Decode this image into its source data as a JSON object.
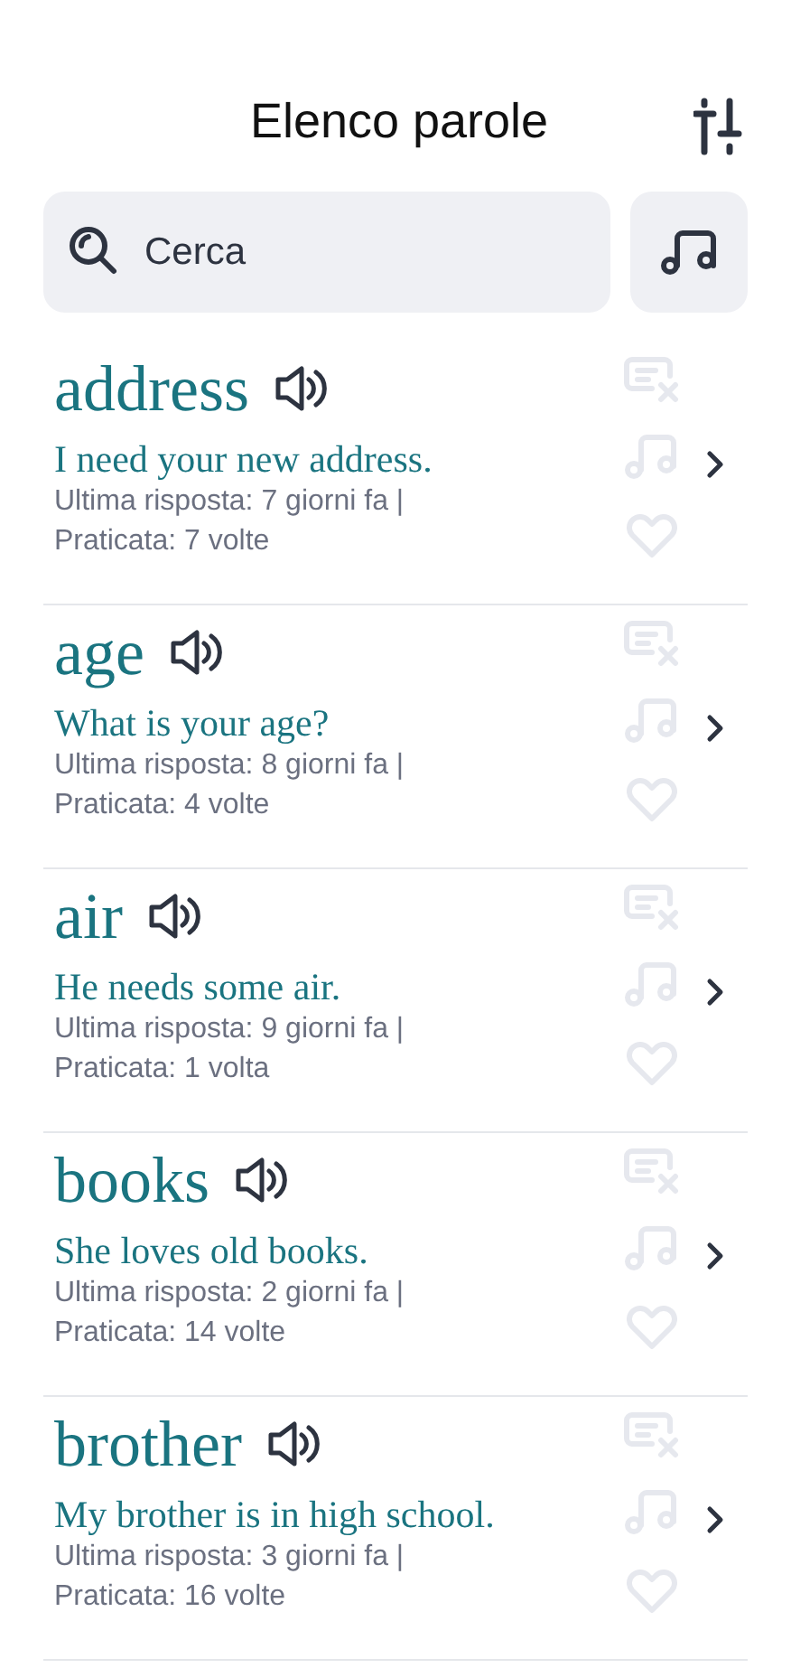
{
  "header": {
    "title": "Elenco parole"
  },
  "search": {
    "placeholder": "Cerca"
  },
  "words": [
    {
      "word": "address",
      "sentence": "I need your new address.",
      "last_answer": "Ultima risposta: 7 giorni fa |",
      "practiced": "Praticata: 7 volte"
    },
    {
      "word": "age",
      "sentence": "What is your age?",
      "last_answer": "Ultima risposta: 8 giorni fa |",
      "practiced": "Praticata: 4 volte"
    },
    {
      "word": "air",
      "sentence": "He needs some air.",
      "last_answer": "Ultima risposta: 9 giorni fa |",
      "practiced": "Praticata: 1 volta"
    },
    {
      "word": "books",
      "sentence": "She loves old books.",
      "last_answer": "Ultima risposta: 2 giorni fa |",
      "practiced": "Praticata: 14 volte"
    },
    {
      "word": "brother",
      "sentence": "My brother is in high school.",
      "last_answer": "Ultima risposta: 3 giorni fa |",
      "practiced": "Praticata: 16 volte"
    }
  ]
}
